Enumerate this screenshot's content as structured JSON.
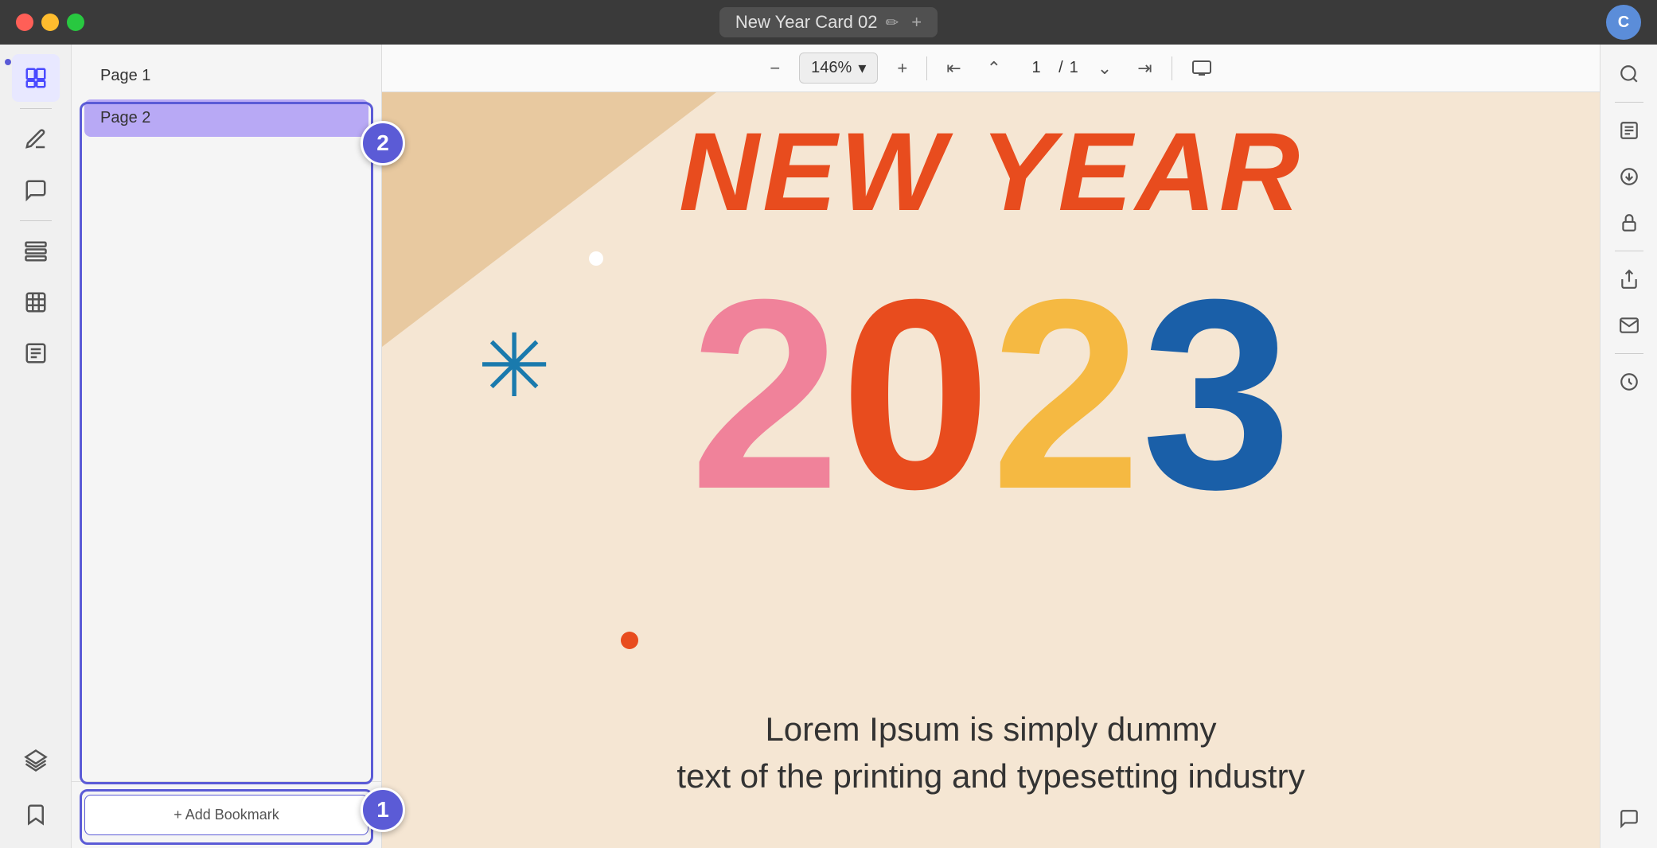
{
  "titlebar": {
    "title": "New Year Card 02",
    "edit_icon": "✏",
    "add_icon": "+",
    "avatar_initials": "C"
  },
  "toolbar": {
    "zoom_out_label": "−",
    "zoom_level": "146%",
    "zoom_in_label": "+",
    "first_page_label": "⇤",
    "prev_page_label": "⌃",
    "current_page": "1",
    "page_separator": "/",
    "total_pages": "1",
    "next_page_label": "⌄",
    "last_page_label": "⇥",
    "present_label": "▷",
    "search_label": "⌕"
  },
  "sidebar": {
    "items": [
      {
        "id": "pages",
        "label": "Pages",
        "icon": "pages"
      },
      {
        "id": "edit",
        "label": "Edit",
        "icon": "edit"
      },
      {
        "id": "annotate",
        "label": "Annotate",
        "icon": "annotate"
      },
      {
        "id": "organize",
        "label": "Organize",
        "icon": "organize"
      },
      {
        "id": "redact",
        "label": "Redact",
        "icon": "redact"
      },
      {
        "id": "forms",
        "label": "Forms",
        "icon": "forms"
      }
    ]
  },
  "pages_panel": {
    "pages": [
      {
        "id": 1,
        "label": "Page 1",
        "selected": false
      },
      {
        "id": 2,
        "label": "Page 2",
        "selected": true
      }
    ],
    "add_bookmark_label": "+ Add Bookmark"
  },
  "annotations": {
    "badge_1": "1",
    "badge_2": "2"
  },
  "right_sidebar": {
    "items": [
      {
        "id": "ocr",
        "label": "OCR"
      },
      {
        "id": "extract",
        "label": "Extract"
      },
      {
        "id": "secure",
        "label": "Secure"
      },
      {
        "id": "share",
        "label": "Share"
      },
      {
        "id": "email",
        "label": "Email"
      },
      {
        "id": "save",
        "label": "Save"
      },
      {
        "id": "comment",
        "label": "Comment"
      }
    ]
  },
  "card": {
    "title_line1": "NEW YEAR",
    "year": "2023",
    "digit_2a": "2",
    "digit_0": "0",
    "digit_2b": "2",
    "digit_3": "3",
    "lorem_text": "Lorem Ipsum is simply dummy\ntext of the printing and typesetting industry"
  }
}
